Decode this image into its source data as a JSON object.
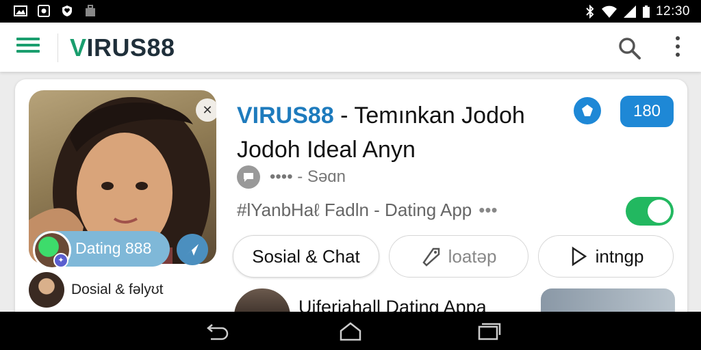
{
  "status_bar": {
    "time": "12:30",
    "left_icons": [
      "image-icon",
      "app-icon",
      "heart-shield-icon",
      "briefcase-icon"
    ],
    "right_icons": [
      "bluetooth-icon",
      "wifi-icon",
      "signal-icon",
      "battery-icon"
    ]
  },
  "app_bar": {
    "title_accent": "V",
    "title_rest": "IRUS88",
    "icons": [
      "menu-icon",
      "search-icon",
      "more-vert-icon"
    ]
  },
  "card": {
    "title_brand": "VIRUS88",
    "title_rest": " - Temınkan Jodoh Jodoh Ideal Anyn",
    "count_badge": "180",
    "meta_text": "•••• - Səɑn",
    "tag_text": "#lYanbHaℓ  Fadln  -  Dating App",
    "tag_dots": "•••",
    "toggle_on": true,
    "dating_pill_label": "Dating 888",
    "small_caption": "Dosial & fəlyʊt",
    "chips": [
      {
        "label": "Sosial & Chat",
        "icon": ""
      },
      {
        "label": "loatəp",
        "icon": "tag-icon"
      },
      {
        "label": "intngp",
        "icon": "play-icon"
      }
    ],
    "list_item_title": "Uiferiahall Dating Appa"
  },
  "colors": {
    "accent_green": "#1a9e6e",
    "brand_blue": "#1e7bbd",
    "badge_blue": "#1e88d6",
    "toggle_green": "#22b860"
  }
}
